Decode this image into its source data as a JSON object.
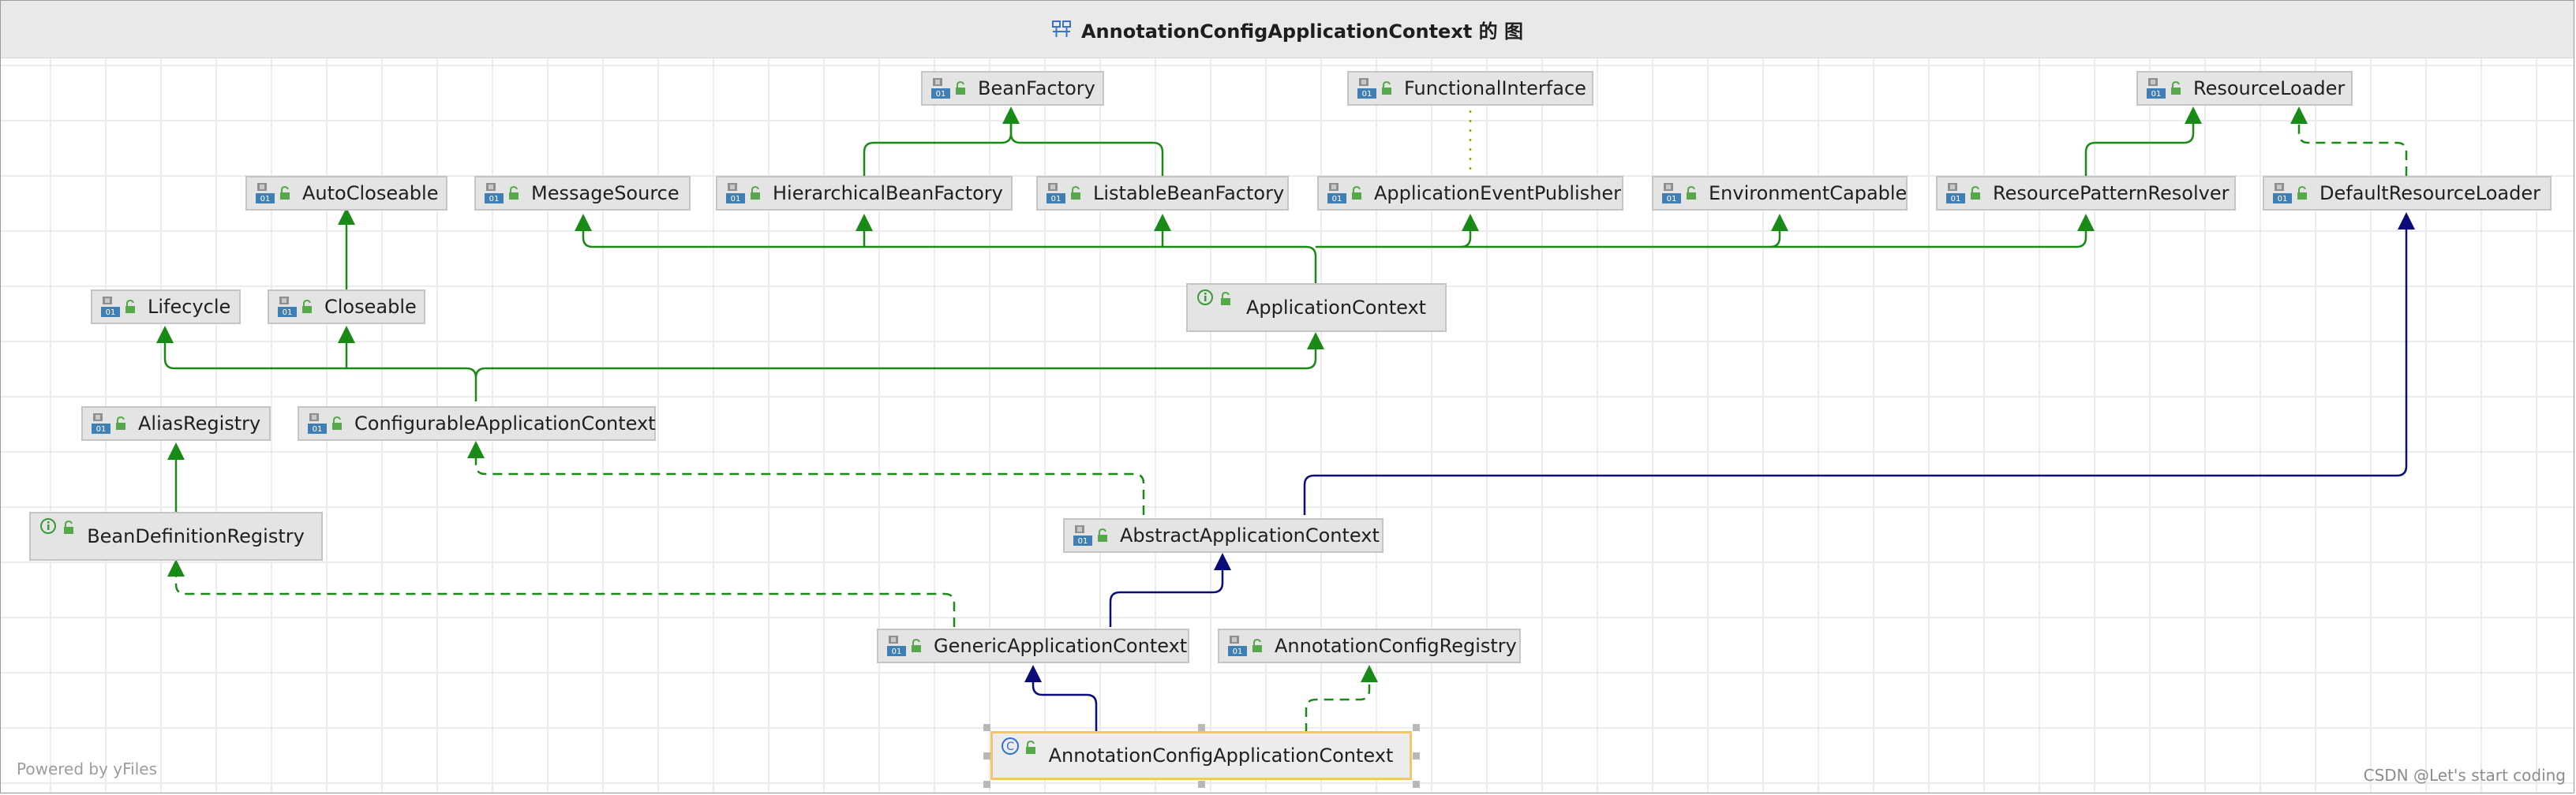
{
  "window": {
    "title": "AnnotationConfigApplicationContext 的 图"
  },
  "colors": {
    "extends_interface": "#1a8a17",
    "extends_class": "#0b0b7a",
    "implements": "#1a8a17",
    "functional_annotation": "#a6a600",
    "selected_border": "#f3c66a"
  },
  "nodes": {
    "bean_factory": {
      "label": "BeanFactory",
      "kind": "interface"
    },
    "functional_interface": {
      "label": "FunctionalInterface",
      "kind": "interface"
    },
    "resource_loader": {
      "label": "ResourceLoader",
      "kind": "interface"
    },
    "auto_closeable": {
      "label": "AutoCloseable",
      "kind": "interface"
    },
    "message_source": {
      "label": "MessageSource",
      "kind": "interface"
    },
    "hierarchical_bean_factory": {
      "label": "HierarchicalBeanFactory",
      "kind": "interface"
    },
    "listable_bean_factory": {
      "label": "ListableBeanFactory",
      "kind": "interface"
    },
    "application_event_publisher": {
      "label": "ApplicationEventPublisher",
      "kind": "interface"
    },
    "environment_capable": {
      "label": "EnvironmentCapable",
      "kind": "interface"
    },
    "resource_pattern_resolver": {
      "label": "ResourcePatternResolver",
      "kind": "interface"
    },
    "default_resource_loader": {
      "label": "DefaultResourceLoader",
      "kind": "interface"
    },
    "lifecycle": {
      "label": "Lifecycle",
      "kind": "interface"
    },
    "closeable": {
      "label": "Closeable",
      "kind": "interface"
    },
    "application_context": {
      "label": "ApplicationContext",
      "kind": "info-interface"
    },
    "alias_registry": {
      "label": "AliasRegistry",
      "kind": "interface"
    },
    "configurable_application_context": {
      "label": "ConfigurableApplicationContext",
      "kind": "interface"
    },
    "bean_definition_registry": {
      "label": "BeanDefinitionRegistry",
      "kind": "info-interface"
    },
    "abstract_application_context": {
      "label": "AbstractApplicationContext",
      "kind": "interface"
    },
    "generic_application_context": {
      "label": "GenericApplicationContext",
      "kind": "interface"
    },
    "annotation_config_registry": {
      "label": "AnnotationConfigRegistry",
      "kind": "interface"
    },
    "annotation_config_application_context": {
      "label": "AnnotationConfigApplicationContext",
      "kind": "class"
    }
  },
  "icons": {
    "interface": "interface-icon",
    "info_interface": "info-interface-icon",
    "class": "class-icon",
    "lock": "open-lock-icon",
    "diagram": "class-diagram-icon"
  },
  "footer": {
    "powered_by": "Powered by yFiles",
    "credit": "CSDN @Let's start coding"
  }
}
